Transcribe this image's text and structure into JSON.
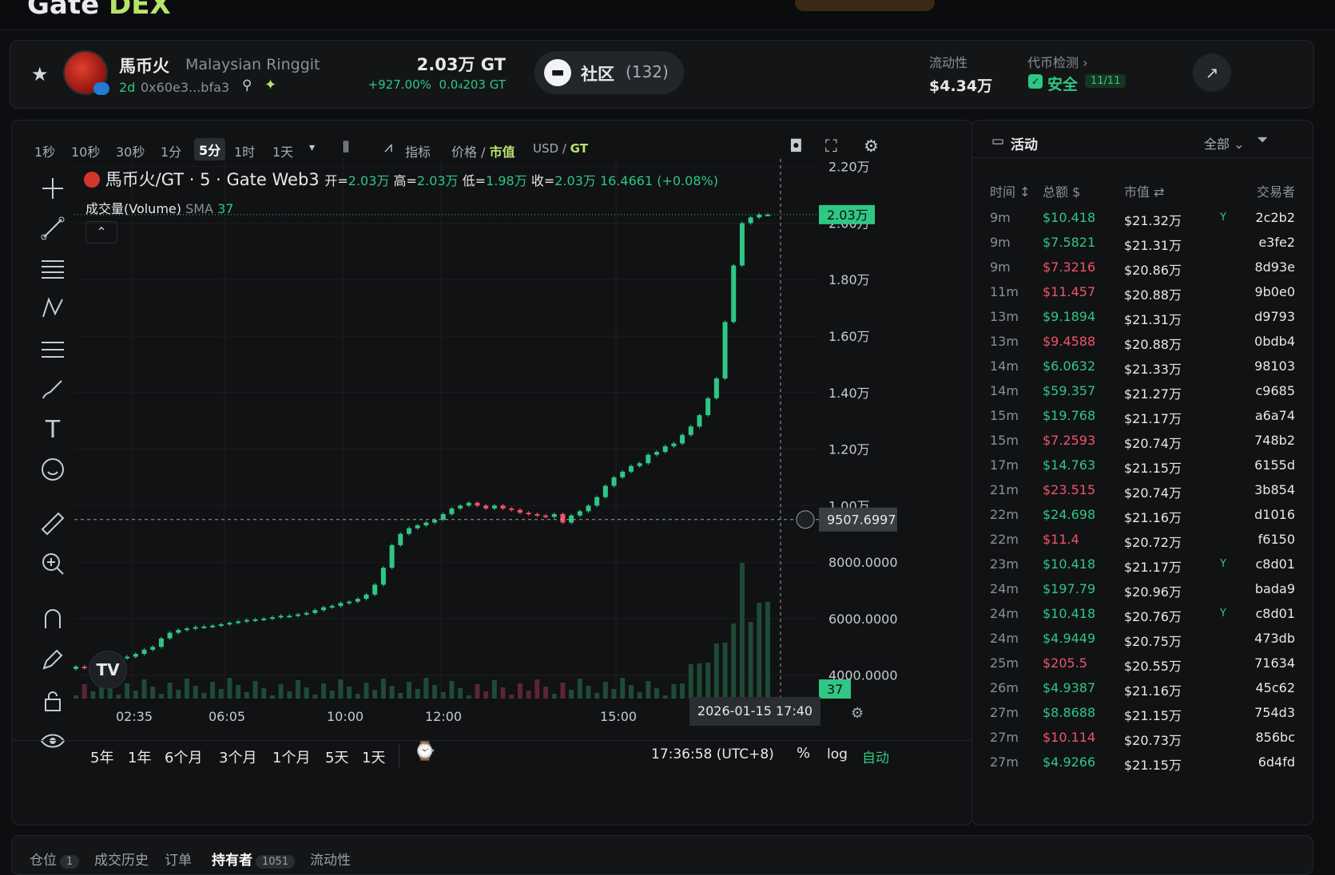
{
  "nav": {
    "logo_main": "Gate",
    "logo_sub": "DEX"
  },
  "token": {
    "name": "馬币火",
    "full_name": "Malaysian Ringgit",
    "age": "2d",
    "address": "0x60e3...bfa3",
    "price": "2.03万 GT",
    "change": "+927.00%",
    "sub_price": "0.0₄203 GT"
  },
  "community": {
    "label": "社区",
    "count": "(132)"
  },
  "stats": {
    "liquidity_label": "流动性",
    "liquidity_value": "$4.34万",
    "check_label": "代币检测",
    "safe_label": "安全",
    "safe_score": "11/11"
  },
  "toolbar": {
    "timeframes": [
      "1秒",
      "10秒",
      "30秒",
      "1分",
      "5分",
      "1时",
      "1天"
    ],
    "active_timeframe": "5分",
    "indicator_label": "指标",
    "price_label": "价格",
    "mcap_label": "市值",
    "usd_label": "USD",
    "gt_label": "GT"
  },
  "legend": {
    "symbol": "馬币火/GT · 5 · Gate Web3",
    "open_label": "开=",
    "open": "2.03万",
    "high_label": "高=",
    "high": "2.03万",
    "low_label": "低=",
    "low": "1.98万",
    "close_label": "收=",
    "close": "2.03万",
    "change": "16.4661 (+0.08%)",
    "volume_label": "成交量(Volume)",
    "sma_label": "SMA",
    "sma_value": "37"
  },
  "chart_data": {
    "type": "candlestick",
    "title": "馬币火/GT · 5 · Gate Web3",
    "y_ticks": [
      "2.20万",
      "2.00万",
      "1.80万",
      "1.60万",
      "1.40万",
      "1.20万",
      "1.00万",
      "8000.0000",
      "6000.0000",
      "4000.0000"
    ],
    "ylim": [
      3000,
      22500
    ],
    "x_ticks": [
      "02:35",
      "06:05",
      "10:00",
      "12:00",
      "15:00"
    ],
    "last_price_label": "2.03万",
    "crosshair_price": "9507.6997",
    "crosshair_time": "2026-01-15  17:40",
    "volume_badge": "37",
    "close_series": [
      4300,
      4250,
      4350,
      4420,
      4500,
      4600,
      4650,
      4750,
      4900,
      5000,
      5300,
      5500,
      5600,
      5650,
      5700,
      5720,
      5750,
      5800,
      5850,
      5900,
      5950,
      5970,
      6000,
      6050,
      6100,
      6100,
      6150,
      6200,
      6300,
      6400,
      6450,
      6550,
      6600,
      6700,
      6850,
      7200,
      7800,
      8600,
      9000,
      9200,
      9300,
      9400,
      9500,
      9700,
      9900,
      10000,
      10100,
      10000,
      9900,
      10000,
      9900,
      9850,
      9750,
      9700,
      9650,
      9600,
      9700,
      9400,
      9650,
      9800,
      10000,
      10300,
      10700,
      11000,
      11200,
      11400,
      11500,
      11800,
      11900,
      12100,
      12200,
      12500,
      12800,
      13200,
      13800,
      14500,
      16500,
      18500,
      20000,
      20200,
      20300,
      20300
    ]
  },
  "ranges": [
    "5年",
    "1年",
    "6个月",
    "3个月",
    "1个月",
    "5天",
    "1天"
  ],
  "status": {
    "time": "17:36:58 (UTC+8)",
    "percent": "%",
    "log": "log",
    "auto": "自动"
  },
  "activity": {
    "title": "活动",
    "filter": "全部",
    "col_time": "时间",
    "col_total": "总额",
    "col_mcap": "市值",
    "col_trader": "交易者",
    "rows": [
      {
        "t": "9m",
        "v": "$10.418",
        "side": "buy",
        "m": "$21.32万",
        "tr": "2c2b2",
        "f": true
      },
      {
        "t": "9m",
        "v": "$7.5821",
        "side": "buy",
        "m": "$21.31万",
        "tr": "e3fe2",
        "f": false
      },
      {
        "t": "9m",
        "v": "$7.3216",
        "side": "sell",
        "m": "$20.86万",
        "tr": "8d93e",
        "f": false
      },
      {
        "t": "11m",
        "v": "$11.457",
        "side": "sell",
        "m": "$20.88万",
        "tr": "9b0e0",
        "f": false
      },
      {
        "t": "13m",
        "v": "$9.1894",
        "side": "buy",
        "m": "$21.31万",
        "tr": "d9793",
        "f": false
      },
      {
        "t": "13m",
        "v": "$9.4588",
        "side": "sell",
        "m": "$20.88万",
        "tr": "0bdb4",
        "f": false
      },
      {
        "t": "14m",
        "v": "$6.0632",
        "side": "buy",
        "m": "$21.33万",
        "tr": "98103",
        "f": false
      },
      {
        "t": "14m",
        "v": "$59.357",
        "side": "buy",
        "m": "$21.27万",
        "tr": "c9685",
        "f": false
      },
      {
        "t": "15m",
        "v": "$19.768",
        "side": "buy",
        "m": "$21.17万",
        "tr": "a6a74",
        "f": false
      },
      {
        "t": "15m",
        "v": "$7.2593",
        "side": "sell",
        "m": "$20.74万",
        "tr": "748b2",
        "f": false
      },
      {
        "t": "17m",
        "v": "$14.763",
        "side": "buy",
        "m": "$21.15万",
        "tr": "6155d",
        "f": false
      },
      {
        "t": "21m",
        "v": "$23.515",
        "side": "sell",
        "m": "$20.74万",
        "tr": "3b854",
        "f": false
      },
      {
        "t": "22m",
        "v": "$24.698",
        "side": "buy",
        "m": "$21.16万",
        "tr": "d1016",
        "f": false
      },
      {
        "t": "22m",
        "v": "$11.4",
        "side": "sell",
        "m": "$20.72万",
        "tr": "f6150",
        "f": false
      },
      {
        "t": "23m",
        "v": "$10.418",
        "side": "buy",
        "m": "$21.17万",
        "tr": "c8d01",
        "f": true
      },
      {
        "t": "24m",
        "v": "$197.79",
        "side": "buy",
        "m": "$20.96万",
        "tr": "bada9",
        "f": false
      },
      {
        "t": "24m",
        "v": "$10.418",
        "side": "buy",
        "m": "$20.76万",
        "tr": "c8d01",
        "f": true
      },
      {
        "t": "24m",
        "v": "$4.9449",
        "side": "buy",
        "m": "$20.75万",
        "tr": "473db",
        "f": false
      },
      {
        "t": "25m",
        "v": "$205.5",
        "side": "sell",
        "m": "$20.55万",
        "tr": "71634",
        "f": false
      },
      {
        "t": "26m",
        "v": "$4.9387",
        "side": "buy",
        "m": "$21.16万",
        "tr": "45c62",
        "f": false
      },
      {
        "t": "27m",
        "v": "$8.8688",
        "side": "buy",
        "m": "$21.15万",
        "tr": "754d3",
        "f": false
      },
      {
        "t": "27m",
        "v": "$10.114",
        "side": "sell",
        "m": "$20.73万",
        "tr": "856bc",
        "f": false
      },
      {
        "t": "27m",
        "v": "$4.9266",
        "side": "buy",
        "m": "$21.15万",
        "tr": "6d4fd",
        "f": false
      }
    ]
  },
  "bottom": {
    "tabs": [
      {
        "label": "仓位",
        "badge": "1"
      },
      {
        "label": "成交历史",
        "badge": ""
      },
      {
        "label": "订单",
        "badge": ""
      },
      {
        "label": "持有者",
        "badge": "1051"
      },
      {
        "label": "流动性",
        "badge": ""
      }
    ]
  },
  "colors": {
    "up": "#2fc784",
    "down": "#f2536b",
    "bg": "#0d0e0f",
    "panel": "#111214"
  }
}
